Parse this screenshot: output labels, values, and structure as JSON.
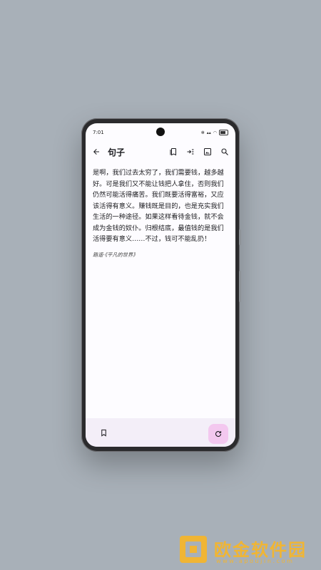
{
  "status": {
    "time": "7:01"
  },
  "app_bar": {
    "title": "句子",
    "icons": [
      "arrow-back-icon",
      "bookmarks-icon",
      "indent-icon",
      "image-icon",
      "search-icon"
    ]
  },
  "quote": {
    "text": "是啊，我们过去太穷了，我们需要钱，越多越好。可是我们又不能让钱把人拿住，否则我们仍然可能活得痛苦。我们既要活得富裕，又应该活得有意义。赚钱既是目的，也是充实我们生活的一种途径。如果这样看待金钱，就不会成为金钱的奴仆。归根结底，最值钱的是我们活得要有意义……不过，钱可不能乱扔！",
    "source": "路遥·《平凡的世界》"
  },
  "bottom_bar": {
    "icons": [
      "bookmark-icon",
      "refresh-icon"
    ],
    "fab_color": "#f3c8ef"
  },
  "watermark": {
    "name": "欧金软件园",
    "url": "www.apoujin.com",
    "color": "#f0b534"
  }
}
